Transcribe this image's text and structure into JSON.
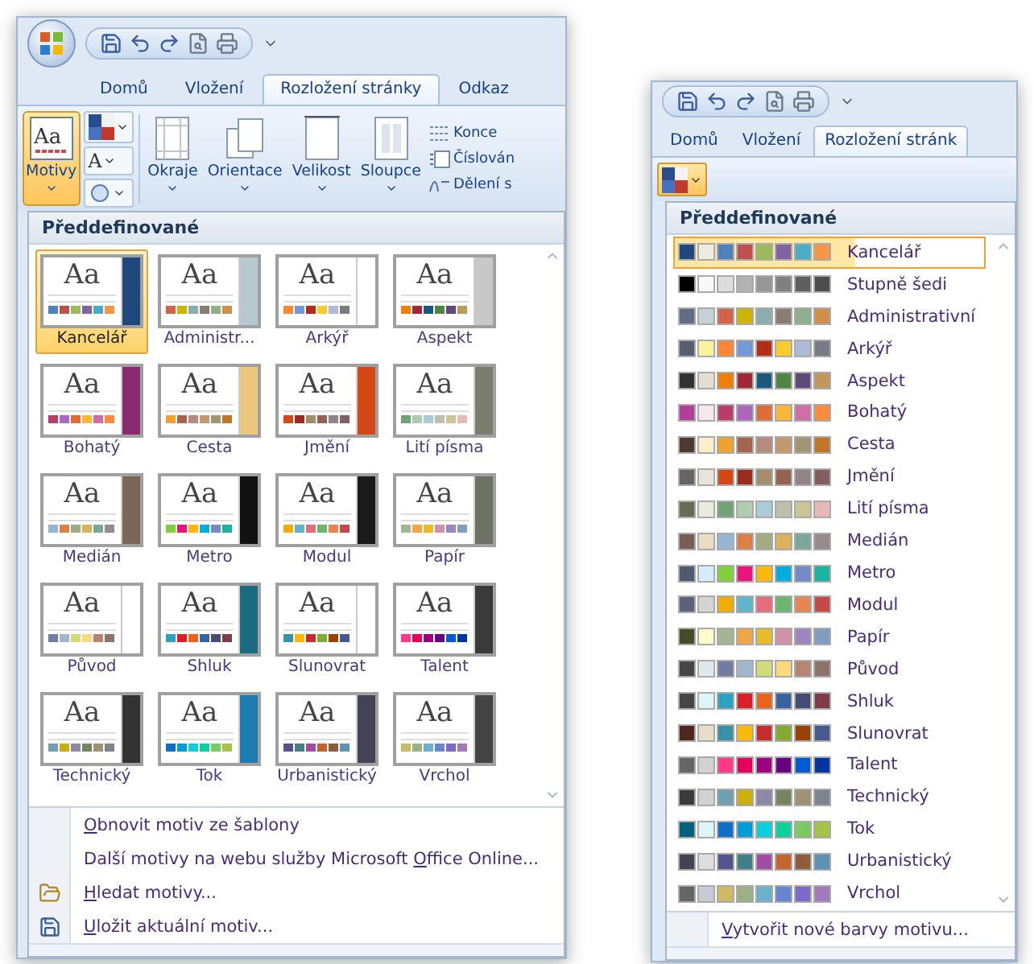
{
  "left_window": {
    "quick_access": [
      {
        "kind": "save"
      },
      {
        "kind": "undo"
      },
      {
        "kind": "redo"
      },
      {
        "kind": "preview"
      },
      {
        "kind": "print"
      }
    ],
    "tabs": [
      {
        "label": "Domů",
        "selected": false
      },
      {
        "label": "Vložení",
        "selected": false
      },
      {
        "label": "Rozložení stránky",
        "selected": true
      },
      {
        "label": "Odkaz",
        "selected": false
      }
    ],
    "theme_button": {
      "label": "Motivy",
      "icon_text": "Aa",
      "selected": true
    },
    "theme_tools": [
      {
        "kind": "colors"
      },
      {
        "kind": "fonts",
        "text": "A"
      },
      {
        "kind": "effects"
      }
    ],
    "page_buttons": [
      {
        "label": "Okraje",
        "kind": "margins"
      },
      {
        "label": "Orientace",
        "kind": "orientation"
      },
      {
        "label": "Velikost",
        "kind": "size"
      },
      {
        "label": "Sloupce",
        "kind": "columns"
      }
    ],
    "side_items": [
      {
        "label": "Konce",
        "kind": "breaks"
      },
      {
        "label": "Číslován",
        "kind": "numbers"
      },
      {
        "label": "Dělení s",
        "kind": "hyphen"
      }
    ],
    "gallery": {
      "header": "Předdefinované",
      "themes": [
        {
          "name": "Kancelář",
          "sample": "Aa",
          "selected": true,
          "stripe": {
            "color": "#1f497d"
          },
          "swatches": [
            {
              "color": "#4f81bd"
            },
            {
              "color": "#c0504d"
            },
            {
              "color": "#9bbb59"
            },
            {
              "color": "#8064a2"
            },
            {
              "color": "#4bacc6"
            },
            {
              "color": "#f79646"
            }
          ]
        },
        {
          "name": "Administr...",
          "sample": "Aa",
          "selected": false,
          "stripe": {
            "color": "#b8c8cf"
          },
          "swatches": [
            {
              "color": "#d16349"
            },
            {
              "color": "#ccb400"
            },
            {
              "color": "#8cadae"
            },
            {
              "color": "#8c7b70"
            },
            {
              "color": "#8fb08c"
            },
            {
              "color": "#d19049"
            }
          ]
        },
        {
          "name": "Arkýř",
          "sample": "Aa",
          "selected": false,
          "stripe": {
            "color": "#ffffff"
          },
          "swatches": [
            {
              "color": "#fe8637"
            },
            {
              "color": "#7598d9"
            },
            {
              "color": "#b32c16"
            },
            {
              "color": "#f5cd2d"
            },
            {
              "color": "#aebad5"
            },
            {
              "color": "#777c84"
            }
          ]
        },
        {
          "name": "Aspekt",
          "sample": "Aa",
          "selected": false,
          "stripe": {
            "color": "#c8c8c8"
          },
          "swatches": [
            {
              "color": "#f07f09"
            },
            {
              "color": "#9f2936"
            },
            {
              "color": "#1b587c"
            },
            {
              "color": "#4e8542"
            },
            {
              "color": "#604878"
            },
            {
              "color": "#c19859"
            }
          ]
        },
        {
          "name": "Bohatý",
          "sample": "Aa",
          "selected": false,
          "stripe": {
            "color": "#8a2a6f"
          },
          "swatches": [
            {
              "color": "#b83d68"
            },
            {
              "color": "#ac66bb"
            },
            {
              "color": "#de6c36"
            },
            {
              "color": "#f9b639"
            },
            {
              "color": "#cf6da4"
            },
            {
              "color": "#fa8d3d"
            }
          ]
        },
        {
          "name": "Cesta",
          "sample": "Aa",
          "selected": false,
          "stripe": {
            "color": "#ebc77c"
          },
          "swatches": [
            {
              "color": "#f0a22e"
            },
            {
              "color": "#a5644e"
            },
            {
              "color": "#b58b80"
            },
            {
              "color": "#c3986d"
            },
            {
              "color": "#a19574"
            },
            {
              "color": "#c17529"
            }
          ]
        },
        {
          "name": "Jmění",
          "sample": "Aa",
          "selected": false,
          "stripe": {
            "color": "#d34817"
          },
          "swatches": [
            {
              "color": "#d34817"
            },
            {
              "color": "#9b2d1f"
            },
            {
              "color": "#a28e6a"
            },
            {
              "color": "#956251"
            },
            {
              "color": "#918485"
            },
            {
              "color": "#855d5d"
            }
          ]
        },
        {
          "name": "Lití písma",
          "sample": "Aa",
          "selected": false,
          "stripe": {
            "color": "#7a7d6c"
          },
          "swatches": [
            {
              "color": "#72a376"
            },
            {
              "color": "#b0ccb0"
            },
            {
              "color": "#a8cdd7"
            },
            {
              "color": "#c0beaf"
            },
            {
              "color": "#cec597"
            },
            {
              "color": "#e8b7b7"
            }
          ]
        },
        {
          "name": "Medián",
          "sample": "Aa",
          "selected": false,
          "stripe": {
            "color": "#7b6559"
          },
          "swatches": [
            {
              "color": "#94b6d2"
            },
            {
              "color": "#dd8047"
            },
            {
              "color": "#a5ab81"
            },
            {
              "color": "#d8b25c"
            },
            {
              "color": "#7ba79d"
            },
            {
              "color": "#968c8c"
            }
          ]
        },
        {
          "name": "Metro",
          "sample": "Aa",
          "selected": false,
          "stripe": {
            "color": "#111111"
          },
          "swatches": [
            {
              "color": "#7fd13b"
            },
            {
              "color": "#ea157a"
            },
            {
              "color": "#feb80a"
            },
            {
              "color": "#00addc"
            },
            {
              "color": "#738ac8"
            },
            {
              "color": "#1ab39f"
            }
          ]
        },
        {
          "name": "Modul",
          "sample": "Aa",
          "selected": false,
          "stripe": {
            "color": "#1a1a1a"
          },
          "swatches": [
            {
              "color": "#f0ad00"
            },
            {
              "color": "#60b5cc"
            },
            {
              "color": "#e66c7d"
            },
            {
              "color": "#6bb76d"
            },
            {
              "color": "#e88651"
            },
            {
              "color": "#c64847"
            }
          ]
        },
        {
          "name": "Papír",
          "sample": "Aa",
          "selected": false,
          "stripe": {
            "color": "#6e7264"
          },
          "swatches": [
            {
              "color": "#a5b592"
            },
            {
              "color": "#f3a447"
            },
            {
              "color": "#e7bc29"
            },
            {
              "color": "#d092a7"
            },
            {
              "color": "#9c85c0"
            },
            {
              "color": "#809ec2"
            }
          ]
        },
        {
          "name": "Původ",
          "sample": "Aa",
          "selected": false,
          "stripe": {
            "color": "#ffffff"
          },
          "swatches": [
            {
              "color": "#727ca3"
            },
            {
              "color": "#9fb8cd"
            },
            {
              "color": "#d2da7a"
            },
            {
              "color": "#fada7a"
            },
            {
              "color": "#b88472"
            },
            {
              "color": "#8e736a"
            }
          ]
        },
        {
          "name": "Shluk",
          "sample": "Aa",
          "selected": false,
          "stripe": {
            "color": "#1b6b80"
          },
          "swatches": [
            {
              "color": "#2da2bf"
            },
            {
              "color": "#da1f28"
            },
            {
              "color": "#eb641b"
            },
            {
              "color": "#39639d"
            },
            {
              "color": "#474b78"
            },
            {
              "color": "#7d3c4a"
            }
          ]
        },
        {
          "name": "Slunovrat",
          "sample": "Aa",
          "selected": false,
          "stripe": {
            "color": "#ffffff"
          },
          "swatches": [
            {
              "color": "#3891a7"
            },
            {
              "color": "#feb80a"
            },
            {
              "color": "#c32d2e"
            },
            {
              "color": "#84aa33"
            },
            {
              "color": "#964305"
            },
            {
              "color": "#475a8d"
            }
          ]
        },
        {
          "name": "Talent",
          "sample": "Aa",
          "selected": false,
          "stripe": {
            "color": "#3a3a3a"
          },
          "swatches": [
            {
              "color": "#ff388c"
            },
            {
              "color": "#e40059"
            },
            {
              "color": "#9c007f"
            },
            {
              "color": "#68007f"
            },
            {
              "color": "#005bd3"
            },
            {
              "color": "#00349e"
            }
          ]
        },
        {
          "name": "Technický",
          "sample": "Aa",
          "selected": false,
          "stripe": {
            "color": "#333333"
          },
          "swatches": [
            {
              "color": "#6ea0b0"
            },
            {
              "color": "#ccaf0a"
            },
            {
              "color": "#8d89a4"
            },
            {
              "color": "#748560"
            },
            {
              "color": "#9e9273"
            },
            {
              "color": "#7e848d"
            }
          ]
        },
        {
          "name": "Tok",
          "sample": "Aa",
          "selected": false,
          "stripe": {
            "color": "#1e7bb0"
          },
          "swatches": [
            {
              "color": "#0f6fc6"
            },
            {
              "color": "#009dd9"
            },
            {
              "color": "#0bd0d9"
            },
            {
              "color": "#10cf9b"
            },
            {
              "color": "#7cca62"
            },
            {
              "color": "#a5c249"
            }
          ]
        },
        {
          "name": "Urbanistický",
          "sample": "Aa",
          "selected": false,
          "stripe": {
            "color": "#424456"
          },
          "swatches": [
            {
              "color": "#53548a"
            },
            {
              "color": "#438086"
            },
            {
              "color": "#a04da3"
            },
            {
              "color": "#c4652d"
            },
            {
              "color": "#8b5d3d"
            },
            {
              "color": "#5c92b5"
            }
          ]
        },
        {
          "name": "Vrchol",
          "sample": "Aa",
          "selected": false,
          "stripe": {
            "color": "#444444"
          },
          "swatches": [
            {
              "color": "#ceb966"
            },
            {
              "color": "#9cb084"
            },
            {
              "color": "#6bb1c9"
            },
            {
              "color": "#6585cf"
            },
            {
              "color": "#7e6bc9"
            },
            {
              "color": "#a379bb"
            }
          ]
        }
      ]
    },
    "menu": [
      {
        "kind": "plain",
        "key": "O",
        "after": "bnovit motiv ze šablony"
      },
      {
        "kind": "plain",
        "before": "Další motivy na webu služby Microsoft ",
        "key": "O",
        "after": "ffice Online..."
      },
      {
        "kind": "browse",
        "key": "H",
        "after": "ledat motivy..."
      },
      {
        "kind": "save",
        "key": "U",
        "after": "ložit aktuální motiv..."
      }
    ]
  },
  "right_window": {
    "quick_access": [
      {
        "kind": "save"
      },
      {
        "kind": "undo"
      },
      {
        "kind": "redo"
      },
      {
        "kind": "preview"
      },
      {
        "kind": "print"
      }
    ],
    "tabs": [
      {
        "label": "Domů",
        "selected": false
      },
      {
        "label": "Vložení",
        "selected": false
      },
      {
        "label": "Rozložení stránk",
        "selected": true
      }
    ],
    "colors_button": {
      "selected": true
    },
    "gallery": {
      "header": "Předdefinované",
      "schemes": [
        {
          "name": "Kancelář",
          "selected": true,
          "colors": [
            {
              "color": "#1f497d"
            },
            {
              "color": "#eeece1"
            },
            {
              "color": "#4f81bd"
            },
            {
              "color": "#c0504d"
            },
            {
              "color": "#9bbb59"
            },
            {
              "color": "#8064a2"
            },
            {
              "color": "#4bacc6"
            },
            {
              "color": "#f79646"
            }
          ]
        },
        {
          "name": "Stupně šedi",
          "selected": false,
          "colors": [
            {
              "color": "#000000"
            },
            {
              "color": "#f8f8f8"
            },
            {
              "color": "#dddddd"
            },
            {
              "color": "#b2b2b2"
            },
            {
              "color": "#969696"
            },
            {
              "color": "#808080"
            },
            {
              "color": "#5f5f5f"
            },
            {
              "color": "#4d4d4d"
            }
          ]
        },
        {
          "name": "Administrativní",
          "selected": false,
          "colors": [
            {
              "color": "#646b86"
            },
            {
              "color": "#c5d1d7"
            },
            {
              "color": "#d16349"
            },
            {
              "color": "#ccb400"
            },
            {
              "color": "#8cadae"
            },
            {
              "color": "#8c7b70"
            },
            {
              "color": "#8fb08c"
            },
            {
              "color": "#d19049"
            }
          ]
        },
        {
          "name": "Arkýř",
          "selected": false,
          "colors": [
            {
              "color": "#575f6d"
            },
            {
              "color": "#fff39d"
            },
            {
              "color": "#fe8637"
            },
            {
              "color": "#7598d9"
            },
            {
              "color": "#b32c16"
            },
            {
              "color": "#f5cd2d"
            },
            {
              "color": "#aebad5"
            },
            {
              "color": "#777c84"
            }
          ]
        },
        {
          "name": "Aspekt",
          "selected": false,
          "colors": [
            {
              "color": "#323232"
            },
            {
              "color": "#e3ded1"
            },
            {
              "color": "#f07f09"
            },
            {
              "color": "#9f2936"
            },
            {
              "color": "#1b587c"
            },
            {
              "color": "#4e8542"
            },
            {
              "color": "#604878"
            },
            {
              "color": "#c19859"
            }
          ]
        },
        {
          "name": "Bohatý",
          "selected": false,
          "colors": [
            {
              "color": "#b13f9a"
            },
            {
              "color": "#f4e7ed"
            },
            {
              "color": "#b83d68"
            },
            {
              "color": "#ac66bb"
            },
            {
              "color": "#de6c36"
            },
            {
              "color": "#f9b639"
            },
            {
              "color": "#cf6da4"
            },
            {
              "color": "#fa8d3d"
            }
          ]
        },
        {
          "name": "Cesta",
          "selected": false,
          "colors": [
            {
              "color": "#4e3b30"
            },
            {
              "color": "#fbeec9"
            },
            {
              "color": "#f0a22e"
            },
            {
              "color": "#a5644e"
            },
            {
              "color": "#b58b80"
            },
            {
              "color": "#c3986d"
            },
            {
              "color": "#a19574"
            },
            {
              "color": "#c17529"
            }
          ]
        },
        {
          "name": "Jmění",
          "selected": false,
          "colors": [
            {
              "color": "#696464"
            },
            {
              "color": "#e9e5dc"
            },
            {
              "color": "#d34817"
            },
            {
              "color": "#9b2d1f"
            },
            {
              "color": "#a28e6a"
            },
            {
              "color": "#956251"
            },
            {
              "color": "#918485"
            },
            {
              "color": "#855d5d"
            }
          ]
        },
        {
          "name": "Lití písma",
          "selected": false,
          "colors": [
            {
              "color": "#676a55"
            },
            {
              "color": "#eaebde"
            },
            {
              "color": "#72a376"
            },
            {
              "color": "#b0ccb0"
            },
            {
              "color": "#a8cdd7"
            },
            {
              "color": "#c0beaf"
            },
            {
              "color": "#cec597"
            },
            {
              "color": "#e8b7b7"
            }
          ]
        },
        {
          "name": "Medián",
          "selected": false,
          "colors": [
            {
              "color": "#775f55"
            },
            {
              "color": "#ebddc3"
            },
            {
              "color": "#94b6d2"
            },
            {
              "color": "#dd8047"
            },
            {
              "color": "#a5ab81"
            },
            {
              "color": "#d8b25c"
            },
            {
              "color": "#7ba79d"
            },
            {
              "color": "#968c8c"
            }
          ]
        },
        {
          "name": "Metro",
          "selected": false,
          "colors": [
            {
              "color": "#4e5b6f"
            },
            {
              "color": "#d6ecff"
            },
            {
              "color": "#7fd13b"
            },
            {
              "color": "#ea157a"
            },
            {
              "color": "#feb80a"
            },
            {
              "color": "#00addc"
            },
            {
              "color": "#738ac8"
            },
            {
              "color": "#1ab39f"
            }
          ]
        },
        {
          "name": "Modul",
          "selected": false,
          "colors": [
            {
              "color": "#5a6378"
            },
            {
              "color": "#d4d4d4"
            },
            {
              "color": "#f0ad00"
            },
            {
              "color": "#60b5cc"
            },
            {
              "color": "#e66c7d"
            },
            {
              "color": "#6bb76d"
            },
            {
              "color": "#e88651"
            },
            {
              "color": "#c64847"
            }
          ]
        },
        {
          "name": "Papír",
          "selected": false,
          "colors": [
            {
              "color": "#444d26"
            },
            {
              "color": "#fefac9"
            },
            {
              "color": "#a5b592"
            },
            {
              "color": "#f3a447"
            },
            {
              "color": "#e7bc29"
            },
            {
              "color": "#d092a7"
            },
            {
              "color": "#9c85c0"
            },
            {
              "color": "#809ec2"
            }
          ]
        },
        {
          "name": "Původ",
          "selected": false,
          "colors": [
            {
              "color": "#464646"
            },
            {
              "color": "#dde9ec"
            },
            {
              "color": "#727ca3"
            },
            {
              "color": "#9fb8cd"
            },
            {
              "color": "#d2da7a"
            },
            {
              "color": "#fada7a"
            },
            {
              "color": "#b88472"
            },
            {
              "color": "#8e736a"
            }
          ]
        },
        {
          "name": "Shluk",
          "selected": false,
          "colors": [
            {
              "color": "#464646"
            },
            {
              "color": "#def5fa"
            },
            {
              "color": "#2da2bf"
            },
            {
              "color": "#da1f28"
            },
            {
              "color": "#eb641b"
            },
            {
              "color": "#39639d"
            },
            {
              "color": "#474b78"
            },
            {
              "color": "#7d3c4a"
            }
          ]
        },
        {
          "name": "Slunovrat",
          "selected": false,
          "colors": [
            {
              "color": "#4f271c"
            },
            {
              "color": "#e7dec9"
            },
            {
              "color": "#3891a7"
            },
            {
              "color": "#feb80a"
            },
            {
              "color": "#c32d2e"
            },
            {
              "color": "#84aa33"
            },
            {
              "color": "#964305"
            },
            {
              "color": "#475a8d"
            }
          ]
        },
        {
          "name": "Talent",
          "selected": false,
          "colors": [
            {
              "color": "#666666"
            },
            {
              "color": "#d2d2d2"
            },
            {
              "color": "#ff388c"
            },
            {
              "color": "#e40059"
            },
            {
              "color": "#9c007f"
            },
            {
              "color": "#68007f"
            },
            {
              "color": "#005bd3"
            },
            {
              "color": "#00349e"
            }
          ]
        },
        {
          "name": "Technický",
          "selected": false,
          "colors": [
            {
              "color": "#3b3b3b"
            },
            {
              "color": "#d4d2d0"
            },
            {
              "color": "#6ea0b0"
            },
            {
              "color": "#ccaf0a"
            },
            {
              "color": "#8d89a4"
            },
            {
              "color": "#748560"
            },
            {
              "color": "#9e9273"
            },
            {
              "color": "#7e848d"
            }
          ]
        },
        {
          "name": "Tok",
          "selected": false,
          "colors": [
            {
              "color": "#04617b"
            },
            {
              "color": "#dbf5f9"
            },
            {
              "color": "#0f6fc6"
            },
            {
              "color": "#009dd9"
            },
            {
              "color": "#0bd0d9"
            },
            {
              "color": "#10cf9b"
            },
            {
              "color": "#7cca62"
            },
            {
              "color": "#a5c249"
            }
          ]
        },
        {
          "name": "Urbanistický",
          "selected": false,
          "colors": [
            {
              "color": "#424456"
            },
            {
              "color": "#dedede"
            },
            {
              "color": "#53548a"
            },
            {
              "color": "#438086"
            },
            {
              "color": "#a04da3"
            },
            {
              "color": "#c4652d"
            },
            {
              "color": "#8b5d3d"
            },
            {
              "color": "#5c92b5"
            }
          ]
        },
        {
          "name": "Vrchol",
          "selected": false,
          "colors": [
            {
              "color": "#666666"
            },
            {
              "color": "#c9c9d8"
            },
            {
              "color": "#ceb966"
            },
            {
              "color": "#9cb084"
            },
            {
              "color": "#6bb1c9"
            },
            {
              "color": "#6585cf"
            },
            {
              "color": "#7e6bc9"
            },
            {
              "color": "#a379bb"
            }
          ]
        }
      ]
    },
    "footer": {
      "key": "V",
      "after": "ytvořit nové barvy motivu..."
    }
  }
}
